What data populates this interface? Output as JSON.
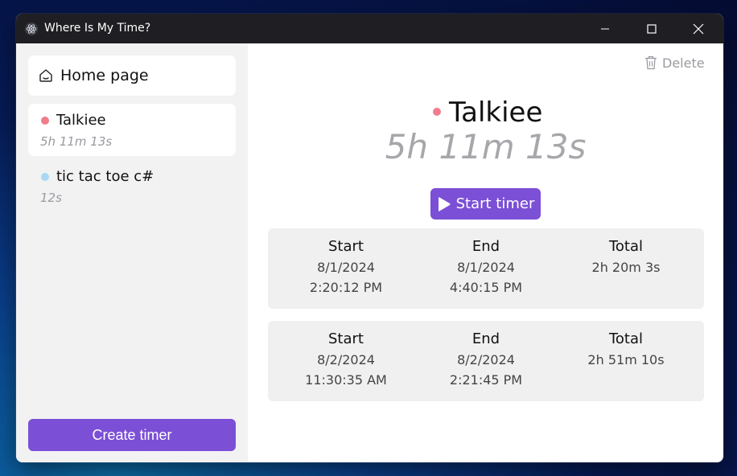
{
  "window": {
    "title": "Where Is My Time?",
    "icon": "electron-atom-icon",
    "controls": [
      "minimize-icon",
      "maximize-icon",
      "close-icon"
    ]
  },
  "sidebar": {
    "home": {
      "label": "Home page",
      "icon": "home-icon"
    },
    "timers": [
      {
        "name": "Talkiee",
        "time": "5h 11m 13s",
        "color": "#f07c8c",
        "active": true
      },
      {
        "name": "tic tac toe c#",
        "time": "12s",
        "color": "#a8d8f5",
        "active": false
      }
    ],
    "create_label": "Create timer"
  },
  "main": {
    "delete_label": "Delete",
    "timer_name": "Talkiee",
    "timer_color": "#f07c8c",
    "total_time": "5h 11m 13s",
    "start_label": "Start timer",
    "sessions": [
      {
        "start_header": "Start",
        "end_header": "End",
        "total_header": "Total",
        "start_date": "8/1/2024",
        "start_time": "2:20:12 PM",
        "end_date": "8/1/2024",
        "end_time": "4:40:15 PM",
        "total": "2h 20m 3s"
      },
      {
        "start_header": "Start",
        "end_header": "End",
        "total_header": "Total",
        "start_date": "8/2/2024",
        "start_time": "11:30:35 AM",
        "end_date": "8/2/2024",
        "end_time": "2:21:45 PM",
        "total": "2h 51m 10s"
      }
    ]
  },
  "colors": {
    "accent": "#7b4fd6",
    "sidebar_bg": "#f2f2f3",
    "session_bg": "#f0f0f0"
  }
}
